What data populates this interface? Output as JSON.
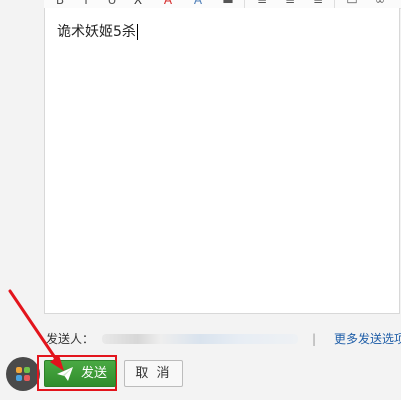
{
  "editor": {
    "body_text": "诡术妖姬5杀"
  },
  "toolbar": {
    "icons": [
      "bold-icon",
      "italic-icon",
      "underline-icon",
      "font-color-icon",
      "highlight-icon",
      "format-icon",
      "align-icon",
      "list-icon",
      "indent-icon",
      "image-icon",
      "attachment-icon"
    ]
  },
  "footer": {
    "sender_label": "发送人：",
    "divider": "|",
    "more_options": "更多发送选项"
  },
  "actions": {
    "send_label": "发送",
    "cancel_label": "取 消"
  },
  "colors": {
    "send_green": "#3a9a35",
    "highlight_red": "#e3141c",
    "link_blue": "#1f5ea8",
    "apps_dots": [
      "#f0a63b",
      "#6fc24a",
      "#4aa3e0",
      "#e85b5b"
    ]
  }
}
